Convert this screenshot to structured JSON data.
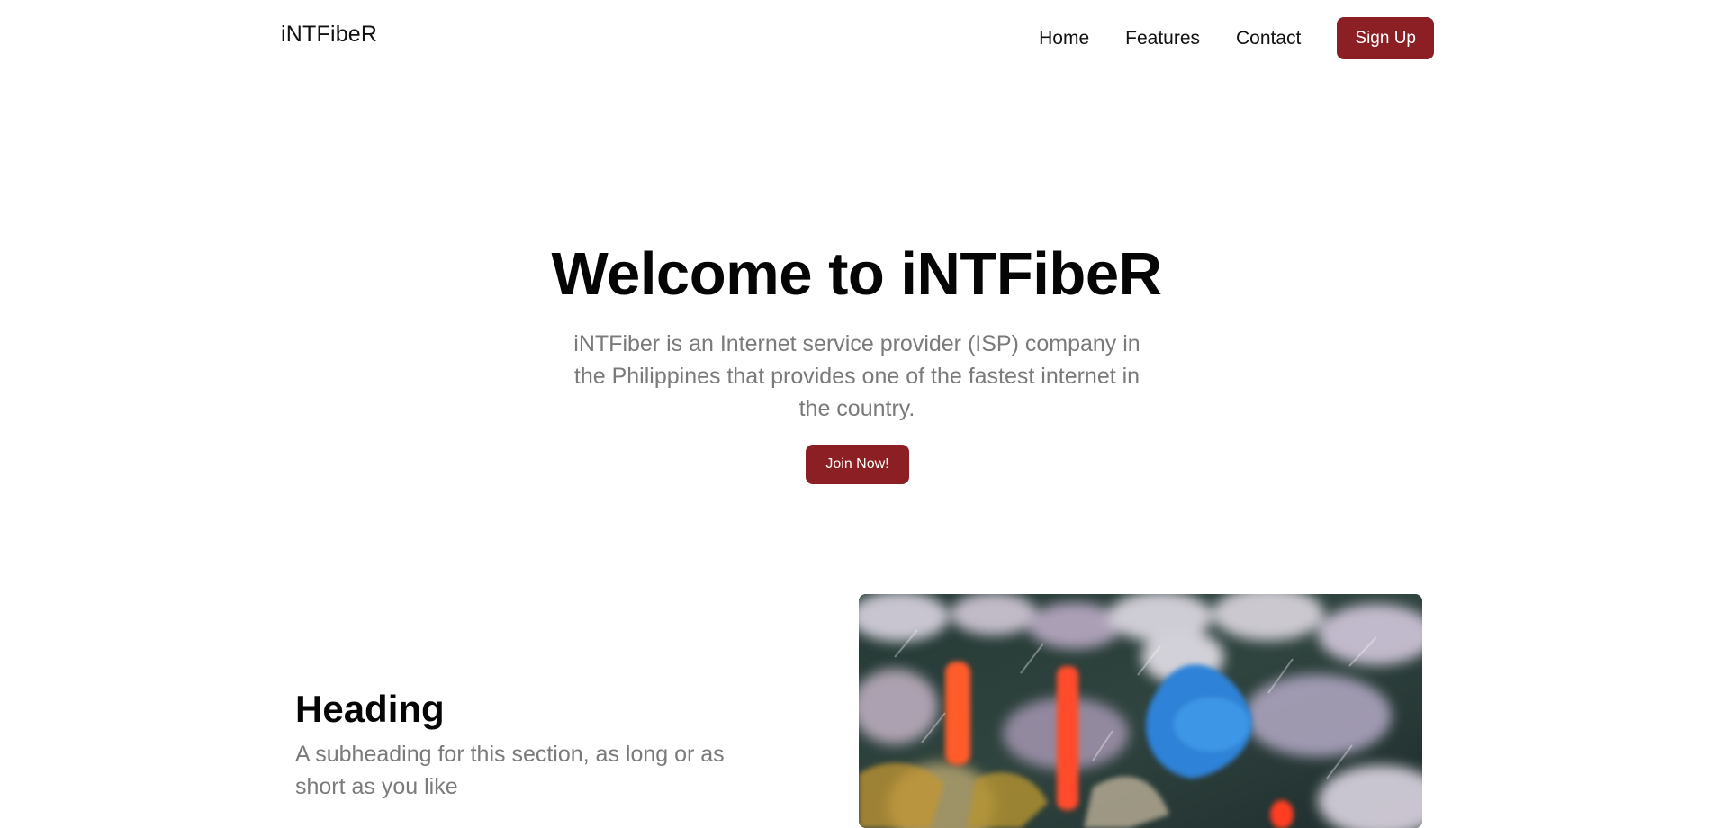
{
  "header": {
    "brand": "iNTFibeR",
    "nav": [
      "Home",
      "Features",
      "Contact"
    ],
    "signup_label": "Sign Up"
  },
  "hero": {
    "title": "Welcome to iNTFibeR",
    "description": "iNTFiber is an Internet service provider (ISP) company in the Philippines that provides one of the fastest internet in the country.",
    "cta_label": "Join Now!"
  },
  "feature": {
    "heading": "Heading",
    "subheading": "A subheading for this section, as long or as short as you like"
  },
  "colors": {
    "accent": "#8b1f24",
    "text": "#111111",
    "muted": "#7a7a7a",
    "background": "#ffffff"
  },
  "icons": {
    "feature_image": "abstract-flowers-image"
  }
}
